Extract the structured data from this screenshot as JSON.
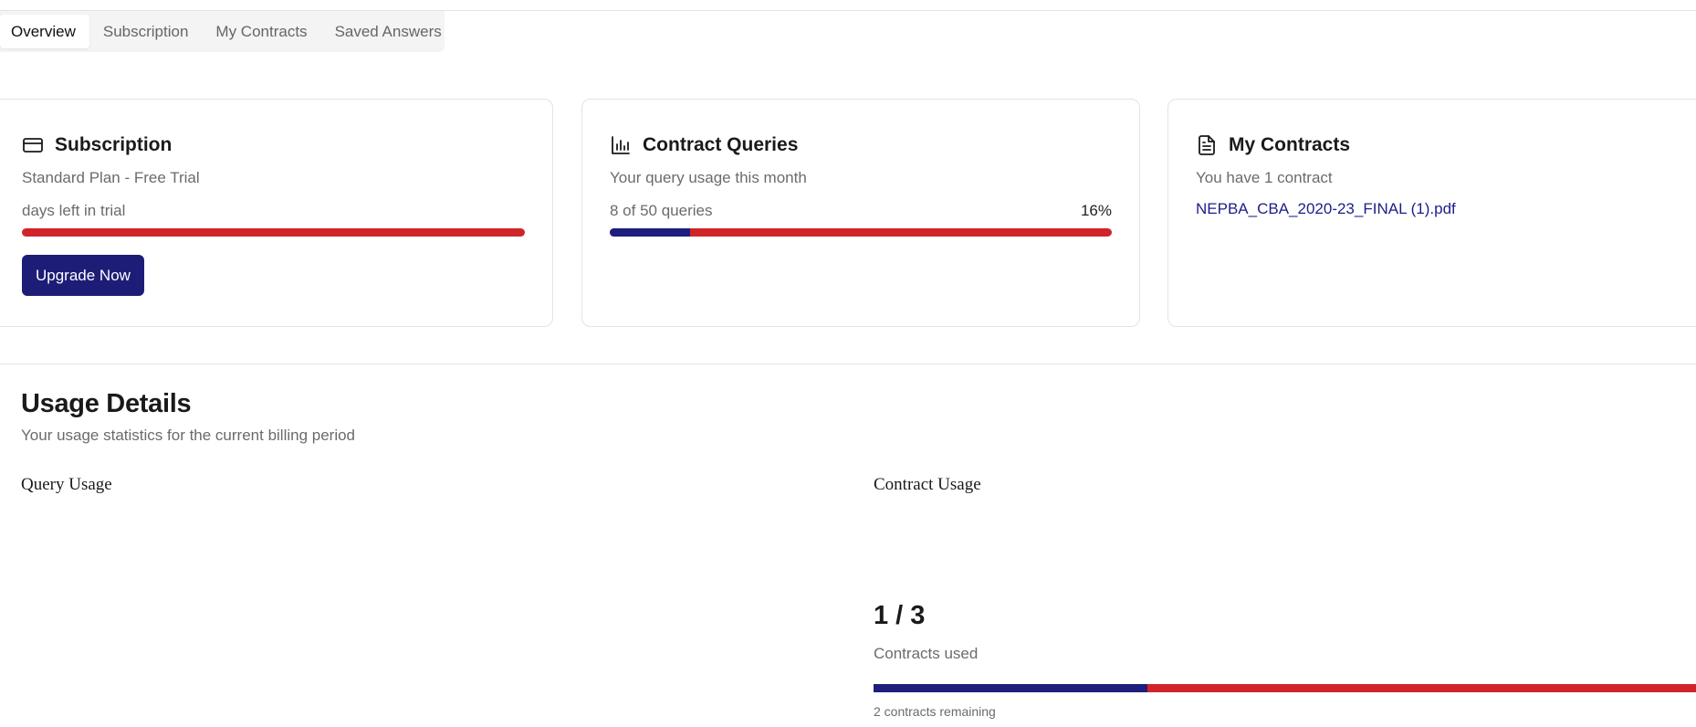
{
  "tabs": [
    {
      "label": "Overview",
      "active": true
    },
    {
      "label": "Subscription",
      "active": false
    },
    {
      "label": "My Contracts",
      "active": false
    },
    {
      "label": "Saved Answers",
      "active": false
    }
  ],
  "cards": {
    "subscription": {
      "icon": "credit-card-icon",
      "title": "Subscription",
      "plan": "Standard Plan - Free Trial",
      "trial_text": "days left in trial",
      "trial_progress": 0,
      "button": "Upgrade Now"
    },
    "queries": {
      "icon": "bar-chart-icon",
      "title": "Contract Queries",
      "desc": "Your query usage this month",
      "usage_text": "8 of 50 queries",
      "percent_text": "16%",
      "used": 8,
      "limit": 50
    },
    "contracts": {
      "icon": "document-icon",
      "title": "My Contracts",
      "desc": "You have 1 contract",
      "file": "NEPBA_CBA_2020-23_FINAL (1).pdf"
    }
  },
  "usage": {
    "title": "Usage Details",
    "subtitle": "Your usage statistics for the current billing period",
    "query_heading": "Query Usage",
    "contract_heading": "Contract Usage",
    "contracts_ratio": "1 / 3",
    "contracts_used_label": "Contracts used",
    "contracts_used": 1,
    "contracts_limit": 3,
    "remaining_text": "2 contracts remaining"
  },
  "colors": {
    "primary": "#1d1d78",
    "bar_track": "#d0242b",
    "link": "#1d1d8a"
  }
}
